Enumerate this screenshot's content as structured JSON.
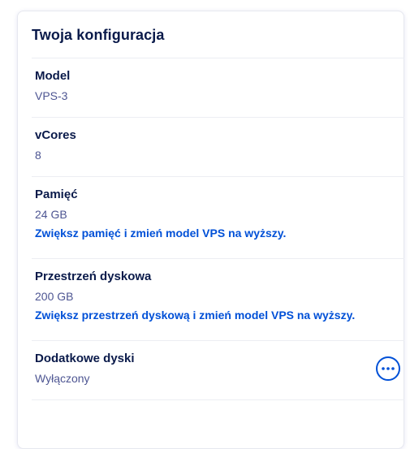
{
  "card": {
    "title": "Twoja konfiguracja"
  },
  "sections": [
    {
      "label": "Model",
      "value": "VPS-3"
    },
    {
      "label": "vCores",
      "value": "8"
    },
    {
      "label": "Pamięć",
      "value": "24 GB",
      "link": "Zwiększ pamięć i zmień model VPS na wyższy."
    },
    {
      "label": "Przestrzeń dyskowa",
      "value": "200 GB",
      "link": "Zwiększ przestrzeń dyskową i zmień model VPS na wyższy."
    },
    {
      "label": "Dodatkowe dyski",
      "value": "Wyłączony",
      "action_icon": "more-horizontal-icon"
    }
  ],
  "colors": {
    "title": "#0a1a4a",
    "value": "#4d5592",
    "link": "#0050d7",
    "divider": "#eceef3"
  }
}
